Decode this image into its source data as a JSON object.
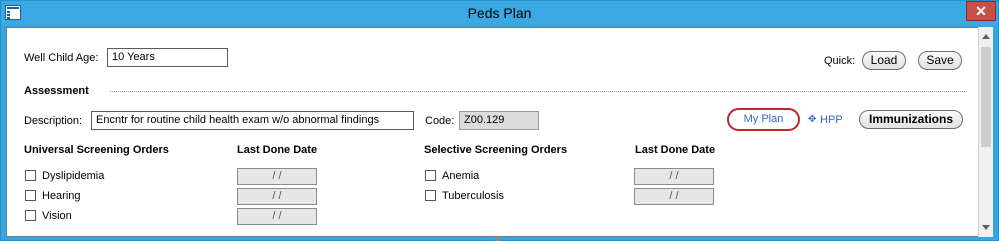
{
  "window": {
    "title": "Peds Plan",
    "close_glyph": "✕"
  },
  "well_child": {
    "label": "Well Child Age:",
    "value": "10 Years"
  },
  "quick": {
    "label": "Quick:",
    "load": "Load",
    "save": "Save"
  },
  "assessment": {
    "heading": "Assessment",
    "description_label": "Description:",
    "description_value": "Encntr for routine child health exam w/o abnormal findings",
    "code_label": "Code:",
    "code_value": "Z00.129",
    "my_plan": "My Plan",
    "hpp_icon": "diamond-dots-icon",
    "hpp": "HPP",
    "immunizations": "Immunizations"
  },
  "universal": {
    "heading": "Universal Screening Orders",
    "date_heading": "Last Done Date",
    "items": [
      {
        "label": "Dyslipidemia",
        "date": " /  / "
      },
      {
        "label": "Hearing",
        "date": " /  / "
      },
      {
        "label": "Vision",
        "date": " /  / "
      }
    ]
  },
  "selective": {
    "heading": "Selective Screening Orders",
    "date_heading": "Last Done Date",
    "items": [
      {
        "label": "Anemia",
        "date": " /  / "
      },
      {
        "label": "Tuberculosis",
        "date": " /  / "
      }
    ]
  },
  "colors": {
    "titlebar": "#3aa9e3",
    "close": "#c7504b",
    "link": "#3366cc",
    "highlight_ring": "#c0272d"
  }
}
